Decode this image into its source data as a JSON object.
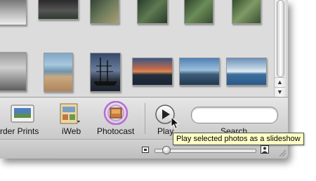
{
  "toolbar": {
    "order_prints_label": "rder Prints",
    "iweb_label": "iWeb",
    "photocast_label": "Photocast",
    "play_label": "Play",
    "search_label": "Search"
  },
  "tooltip": {
    "text": "Play selected photos as a slideshow"
  },
  "scrollbar": {
    "up_arrow": "▲",
    "down_arrow": "▼"
  },
  "icons": {
    "order_prints": "order-prints-icon",
    "iweb": "iweb-icon",
    "photocast": "photocast-icon",
    "play": "play-icon",
    "pointer": "mouse-pointer-icon",
    "zoom_small": "small-photo-icon",
    "zoom_large": "large-photo-icon"
  },
  "colors": {
    "tooltip_bg": "#ffffc6",
    "photocast_ring": "#b86bd6",
    "toolbar_bg": "#d6d6d6"
  },
  "zoom": {
    "level": 0.08
  }
}
